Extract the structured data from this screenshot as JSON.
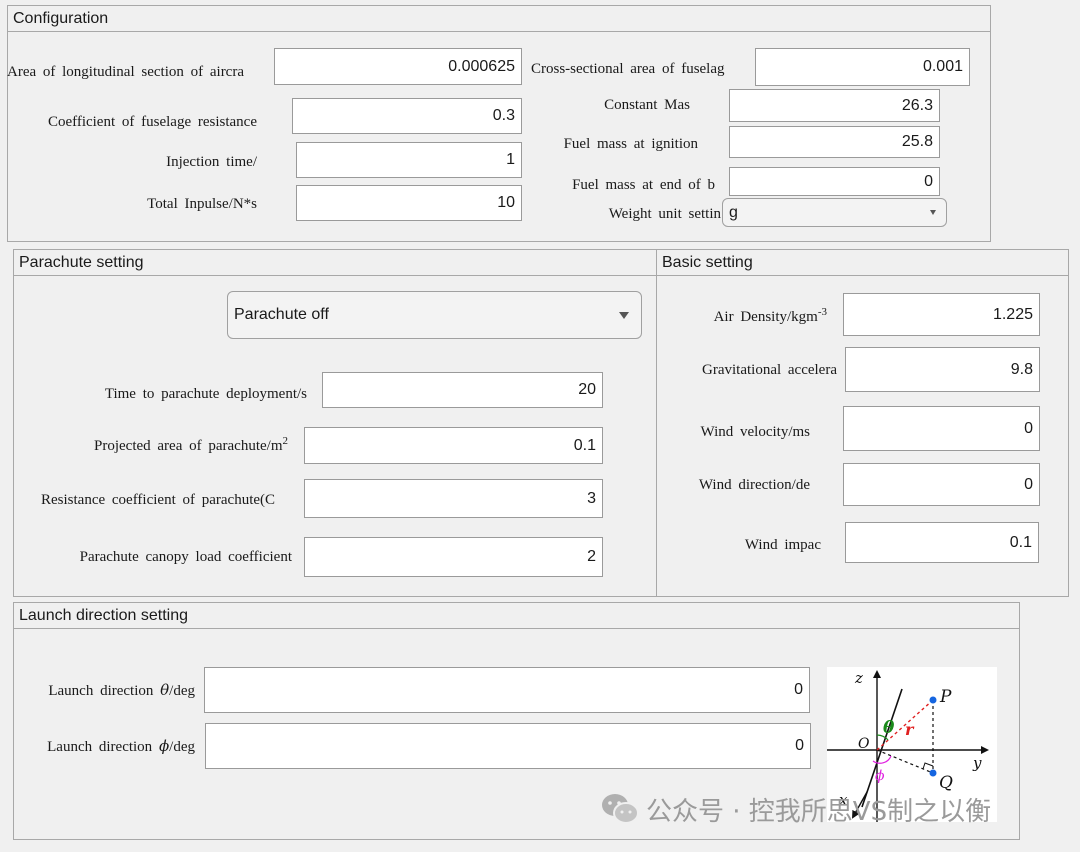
{
  "configuration": {
    "title": "Configuration",
    "longitudinal_area_label": "Area of longitudinal section of aircra",
    "longitudinal_area_value": "0.000625",
    "cross_section_area_label": "Cross-sectional area of fuselag",
    "cross_section_area_value": "0.001",
    "fuselage_resistance_label": "Coefficient of fuselage resistance",
    "fuselage_resistance_value": "0.3",
    "constant_mass_label": "Constant Mas",
    "constant_mass_value": "26.3",
    "injection_time_label": "Injection time/",
    "injection_time_value": "1",
    "fuel_mass_ignition_label": "Fuel mass at ignition",
    "fuel_mass_ignition_value": "25.8",
    "fuel_mass_end_label": "Fuel mass at end of b",
    "fuel_mass_end_value": "0",
    "total_impulse_label": "Total Inpulse/N*s",
    "total_impulse_value": "10",
    "weight_unit_label": "Weight unit settin",
    "weight_unit_value": "g"
  },
  "parachute": {
    "title": "Parachute setting",
    "mode_value": "Parachute off",
    "deploy_time_label": "Time to parachute deployment/s",
    "deploy_time_value": "20",
    "projected_area_label": "Projected area of parachute/m",
    "projected_area_sup": "2",
    "projected_area_value": "0.1",
    "resistance_label": "Resistance coefficient of parachute(C",
    "resistance_value": "3",
    "canopy_load_label": "Parachute canopy load coefficient",
    "canopy_load_value": "2"
  },
  "basic": {
    "title": "Basic setting",
    "air_density_label": "Air Density/kgm",
    "air_density_sup": "-3",
    "air_density_value": "1.225",
    "gravity_label": "Gravitational accelera",
    "gravity_value": "9.8",
    "wind_velocity_label": "Wind velocity/ms",
    "wind_velocity_value": "0",
    "wind_direction_label": "Wind direction/de",
    "wind_direction_value": "0",
    "wind_impact_label": "Wind impac",
    "wind_impact_value": "0.1"
  },
  "launch": {
    "title": "Launch direction setting",
    "theta_label_pre": "Launch direction ",
    "theta_symbol": "θ",
    "theta_label_post": "/deg",
    "theta_value": "0",
    "phi_label_pre": "Launch direction ",
    "phi_symbol": "ϕ",
    "phi_label_post": "/deg",
    "phi_value": "0"
  },
  "diagram": {
    "z": "z",
    "y": "y",
    "x": "x",
    "o": "O",
    "p": "P",
    "q": "Q",
    "theta": "θ",
    "r": "r",
    "phi": "ϕ",
    "colors": {
      "point": "#1565e0",
      "r_line": "#e02020",
      "theta": "#1a8a1a",
      "phi": "#e020e0"
    }
  },
  "watermark": {
    "text": "公众号 · 控我所思VS制之以衡",
    "icon": "wechat-icon"
  }
}
